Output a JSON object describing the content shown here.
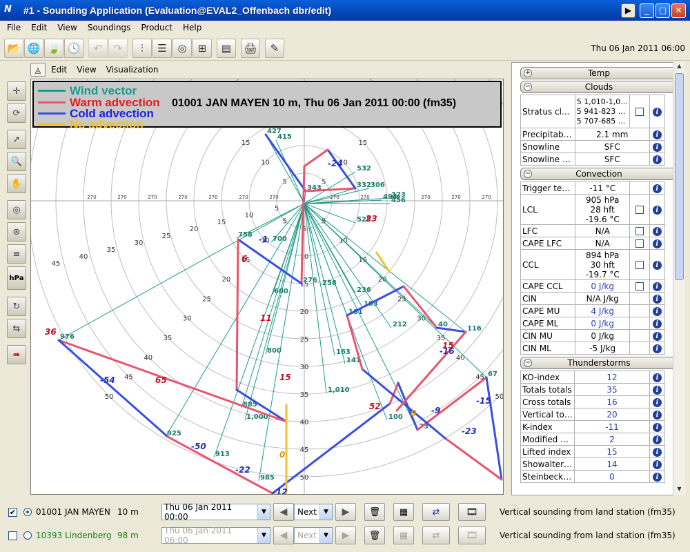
{
  "window": {
    "title": "#1 - Sounding Application (Evaluation@EVAL2_Offenbach dbr/edit)"
  },
  "menubar": [
    "File",
    "Edit",
    "View",
    "Soundings",
    "Product",
    "Help"
  ],
  "toolbar": {
    "datetime": "Thu 06 Jan 2011 06:00"
  },
  "viz_menu": [
    "Edit",
    "View",
    "Visualization"
  ],
  "legend": {
    "items": [
      {
        "label": "Wind vector",
        "color": "#1a9b8a"
      },
      {
        "label": "Warm advection",
        "color": "#e8546e"
      },
      {
        "label": "Cold advection",
        "color": "#3a4ee0"
      },
      {
        "label": "No advection",
        "color": "#f2c22a"
      }
    ],
    "title": "01001 JAN MAYEN 10 m, Thu 06 Jan 2011 00:00 (fm35)"
  },
  "panel": {
    "sections": {
      "temp": "Temp",
      "clouds": "Clouds",
      "convection": "Convection",
      "thunderstorms": "Thunderstorms"
    },
    "clouds": {
      "stratus_name": "Stratus clou...",
      "stratus_values": [
        "5  1,010-1,0...",
        "5  941-823 ...",
        "5  707-685 ..."
      ],
      "rows": [
        {
          "name": "Precipitable ...",
          "value": "2.1 mm"
        },
        {
          "name": "Snowline",
          "value": "SFC"
        },
        {
          "name": "Snowline D...",
          "value": "SFC"
        }
      ]
    },
    "convection": [
      {
        "name": "Trigger tem...",
        "value": "-11 °C",
        "check": false
      },
      {
        "name": "LCL",
        "lines": [
          "905 hPa",
          "28 hft",
          "-19.6 °C"
        ],
        "check": true
      },
      {
        "name": "LFC",
        "value": "N/A",
        "check": true
      },
      {
        "name": "CAPE LFC",
        "value": "N/A",
        "check": true
      },
      {
        "name": "CCL",
        "lines": [
          "894 hPa",
          "30 hft",
          "-19.7 °C"
        ],
        "check": true
      },
      {
        "name": "CAPE CCL",
        "value": "0 J/kg",
        "check": true,
        "blue": true
      },
      {
        "name": "CIN",
        "value": "N/A J/kg",
        "check": false
      },
      {
        "name": "CAPE MU",
        "value": "4 J/kg",
        "check": false,
        "blue": true
      },
      {
        "name": "CAPE ML",
        "value": "0 J/kg",
        "check": false,
        "blue": true
      },
      {
        "name": "CIN MU",
        "value": "0 J/kg",
        "check": false
      },
      {
        "name": "CIN ML",
        "value": "-5 J/kg",
        "check": false
      }
    ],
    "thunderstorms": [
      {
        "name": "KO-index",
        "value": "12"
      },
      {
        "name": "Totals totals",
        "value": "35"
      },
      {
        "name": "Cross totals",
        "value": "16"
      },
      {
        "name": "Vertical totals",
        "value": "20"
      },
      {
        "name": "K-index",
        "value": "-11"
      },
      {
        "name": "Modified K-i...",
        "value": "2"
      },
      {
        "name": "Lifted index",
        "value": "15"
      },
      {
        "name": "Showalter in...",
        "value": "14"
      },
      {
        "name": "Steinbeck in...",
        "value": "0"
      }
    ]
  },
  "stations": [
    {
      "checked": true,
      "selected": true,
      "name": "01001 JAN MAYEN",
      "height": "10 m",
      "date": "Thu 06 Jan 2011 00:00",
      "step": "Next",
      "description": "Vertical sounding from land station (fm35)",
      "enabled": true
    },
    {
      "checked": false,
      "selected": false,
      "name": "10393 Lindenberg",
      "height": "98 m",
      "date": "Thu 06 Jan 2011 06:00",
      "step": "Next",
      "description": "Vertical sounding from land station (fm35)",
      "enabled": false
    }
  ],
  "hodograph": {
    "ring_labels": [
      "5",
      "10",
      "15",
      "20",
      "25",
      "30",
      "35",
      "40",
      "45",
      "50"
    ],
    "direction_label": "270",
    "points": [
      {
        "label": "427",
        "color": "#1a7a6a"
      },
      {
        "label": "415",
        "color": "#1a7a6a"
      },
      {
        "label": "343",
        "color": "#1a7a6a"
      },
      {
        "label": "332",
        "color": "#1a7a6a"
      },
      {
        "label": "323",
        "color": "#1a7a6a"
      },
      {
        "label": "306",
        "color": "#1a7a6a"
      },
      {
        "label": "276",
        "color": "#1a7a6a"
      },
      {
        "label": "258",
        "color": "#1a7a6a"
      },
      {
        "label": "236",
        "color": "#1a7a6a"
      },
      {
        "label": "212",
        "color": "#1a7a6a"
      },
      {
        "label": "193",
        "color": "#1a7a6a"
      },
      {
        "label": "181",
        "color": "#1a7a6a"
      },
      {
        "label": "163",
        "color": "#1a7a6a"
      },
      {
        "label": "141",
        "color": "#1a7a6a"
      },
      {
        "label": "116",
        "color": "#1a7a6a"
      },
      {
        "label": "100",
        "color": "#1a7a6a"
      },
      {
        "label": "73",
        "color": "#1a7a6a"
      },
      {
        "label": "67",
        "color": "#1a7a6a"
      },
      {
        "label": "40",
        "color": "#1a7a6a"
      },
      {
        "label": "1,010",
        "color": "#1a7a6a"
      },
      {
        "label": "1,000",
        "color": "#1a7a6a"
      },
      {
        "label": "985",
        "color": "#1a7a6a"
      },
      {
        "label": "976",
        "color": "#1a7a6a"
      },
      {
        "label": "925",
        "color": "#1a7a6a"
      },
      {
        "label": "913",
        "color": "#1a7a6a"
      },
      {
        "label": "885",
        "color": "#1a7a6a"
      },
      {
        "label": "800",
        "color": "#1a7a6a"
      },
      {
        "label": "758",
        "color": "#1a7a6a"
      },
      {
        "label": "700",
        "color": "#1a7a6a"
      },
      {
        "label": "600",
        "color": "#1a7a6a"
      },
      {
        "label": "532",
        "color": "#1a7a6a"
      },
      {
        "label": "525",
        "color": "#1a7a6a"
      },
      {
        "label": "494",
        "color": "#1a7a6a"
      },
      {
        "label": "456",
        "color": "#1a7a6a"
      }
    ],
    "advection_labels": [
      {
        "label": "-24",
        "color": "#1f2fb0"
      },
      {
        "label": "-54",
        "color": "#1f2fb0"
      },
      {
        "label": "-50",
        "color": "#1f2fb0"
      },
      {
        "label": "-22",
        "color": "#1f2fb0"
      },
      {
        "label": "-12",
        "color": "#1f2fb0"
      },
      {
        "label": "-1",
        "color": "#1f2fb0"
      },
      {
        "label": "-9",
        "color": "#1f2fb0"
      },
      {
        "label": "-23",
        "color": "#1f2fb0"
      },
      {
        "label": "-15",
        "color": "#1f2fb0"
      },
      {
        "label": "-16",
        "color": "#1f2fb0"
      },
      {
        "label": "36",
        "color": "#c01020"
      },
      {
        "label": "65",
        "color": "#c01020"
      },
      {
        "label": "15",
        "color": "#c01020"
      },
      {
        "label": "11",
        "color": "#c01020"
      },
      {
        "label": "6",
        "color": "#c01020"
      },
      {
        "label": "23",
        "color": "#c01020"
      },
      {
        "label": "52",
        "color": "#c01020"
      },
      {
        "label": "15",
        "color": "#c01020"
      },
      {
        "label": "0",
        "color": "#d89a00"
      },
      {
        "label": "0",
        "color": "#d89a00"
      }
    ]
  }
}
